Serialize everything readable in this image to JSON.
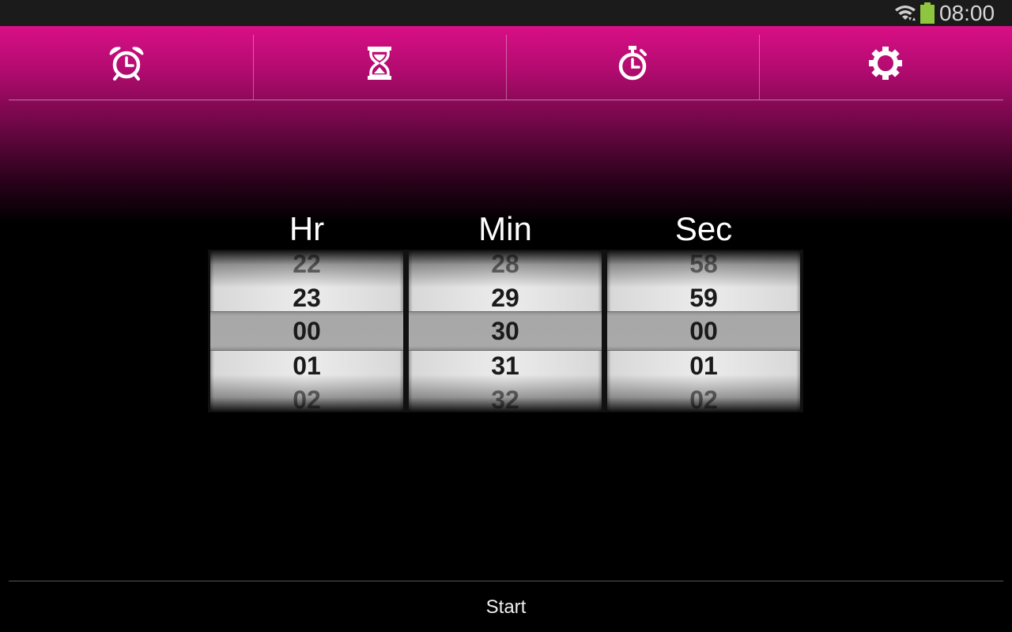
{
  "status_bar": {
    "time": "08:00",
    "icons": [
      "wifi-icon",
      "battery-icon"
    ],
    "battery_color": "#8ec63f"
  },
  "theme": {
    "accent": "#d90f86",
    "background": "#000000"
  },
  "tabs": [
    {
      "name": "alarm",
      "icon": "alarm-clock-icon"
    },
    {
      "name": "timer",
      "icon": "hourglass-icon"
    },
    {
      "name": "stopwatch",
      "icon": "stopwatch-icon"
    },
    {
      "name": "settings",
      "icon": "gear-icon"
    }
  ],
  "picker": {
    "columns": [
      {
        "label": "Hr",
        "values": [
          "22",
          "23",
          "00",
          "01",
          "02"
        ],
        "selected": "00"
      },
      {
        "label": "Min",
        "values": [
          "28",
          "29",
          "30",
          "31",
          "32"
        ],
        "selected": "30"
      },
      {
        "label": "Sec",
        "values": [
          "58",
          "59",
          "00",
          "01",
          "02"
        ],
        "selected": "00"
      }
    ]
  },
  "start_label": "Start"
}
